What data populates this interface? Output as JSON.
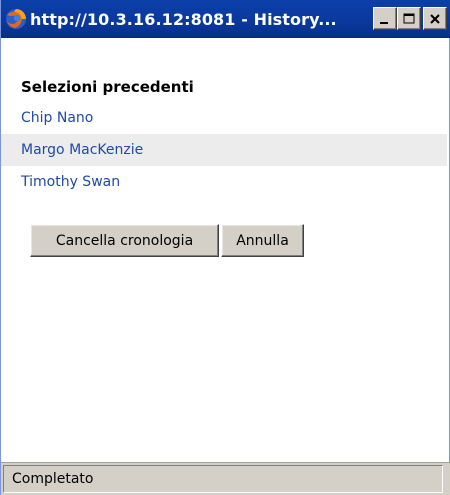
{
  "window": {
    "title": "http://10.3.16.12:8081 - History...",
    "accent_color": "#0a3aa0"
  },
  "content": {
    "heading": "Selezioni precedenti",
    "items": [
      {
        "label": "Chip Nano"
      },
      {
        "label": "Margo MacKenzie"
      },
      {
        "label": "Timothy Swan"
      }
    ],
    "link_color": "#1f4aa8",
    "buttons": {
      "clear_history": "Cancella cronologia",
      "cancel": "Annulla"
    }
  },
  "statusbar": {
    "text": "Completato"
  },
  "icons": {
    "app": "firefox-icon",
    "minimize": "minimize-icon",
    "maximize": "maximize-icon",
    "close": "close-icon"
  }
}
